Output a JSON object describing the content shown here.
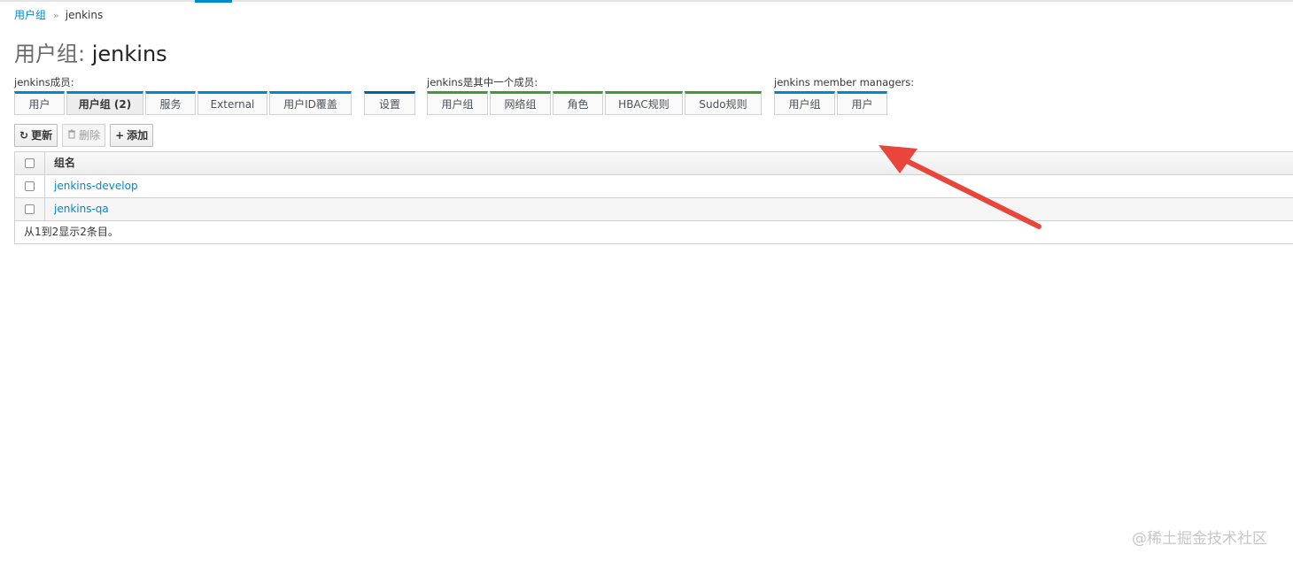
{
  "breadcrumb": {
    "parent": "用户组",
    "separator": "»",
    "current": "jenkins"
  },
  "title": {
    "prefix": "用户组:",
    "name": "jenkins"
  },
  "facets": {
    "members": {
      "label": "jenkins成员:",
      "tabs": [
        "用户",
        "用户组 (2)",
        "服务",
        "External",
        "用户ID覆盖"
      ],
      "active": "用户组 (2)"
    },
    "settings": {
      "tabs": [
        "设置"
      ]
    },
    "member_of": {
      "label": "jenkins是其中一个成员:",
      "tabs": [
        "用户组",
        "网络组",
        "角色",
        "HBAC规则",
        "Sudo规则"
      ]
    },
    "managers": {
      "label": "jenkins member managers:",
      "tabs": [
        "用户组",
        "用户"
      ]
    }
  },
  "toolbar": {
    "refresh_icon": "refresh-icon",
    "refresh_label": "更新",
    "delete_icon": "trash-icon",
    "delete_label": "删除",
    "add_icon": "plus-icon",
    "add_label": "添加"
  },
  "table": {
    "header": "组名",
    "rows": [
      "jenkins-develop",
      "jenkins-qa"
    ],
    "footer": "从1到2显示2条目。"
  },
  "annotation": {
    "arrow_color": "#e8463d"
  },
  "watermark": "@稀土掘金技术社区",
  "colors": {
    "accent": "#0088ce",
    "member_of_accent": "#3f9c35"
  }
}
